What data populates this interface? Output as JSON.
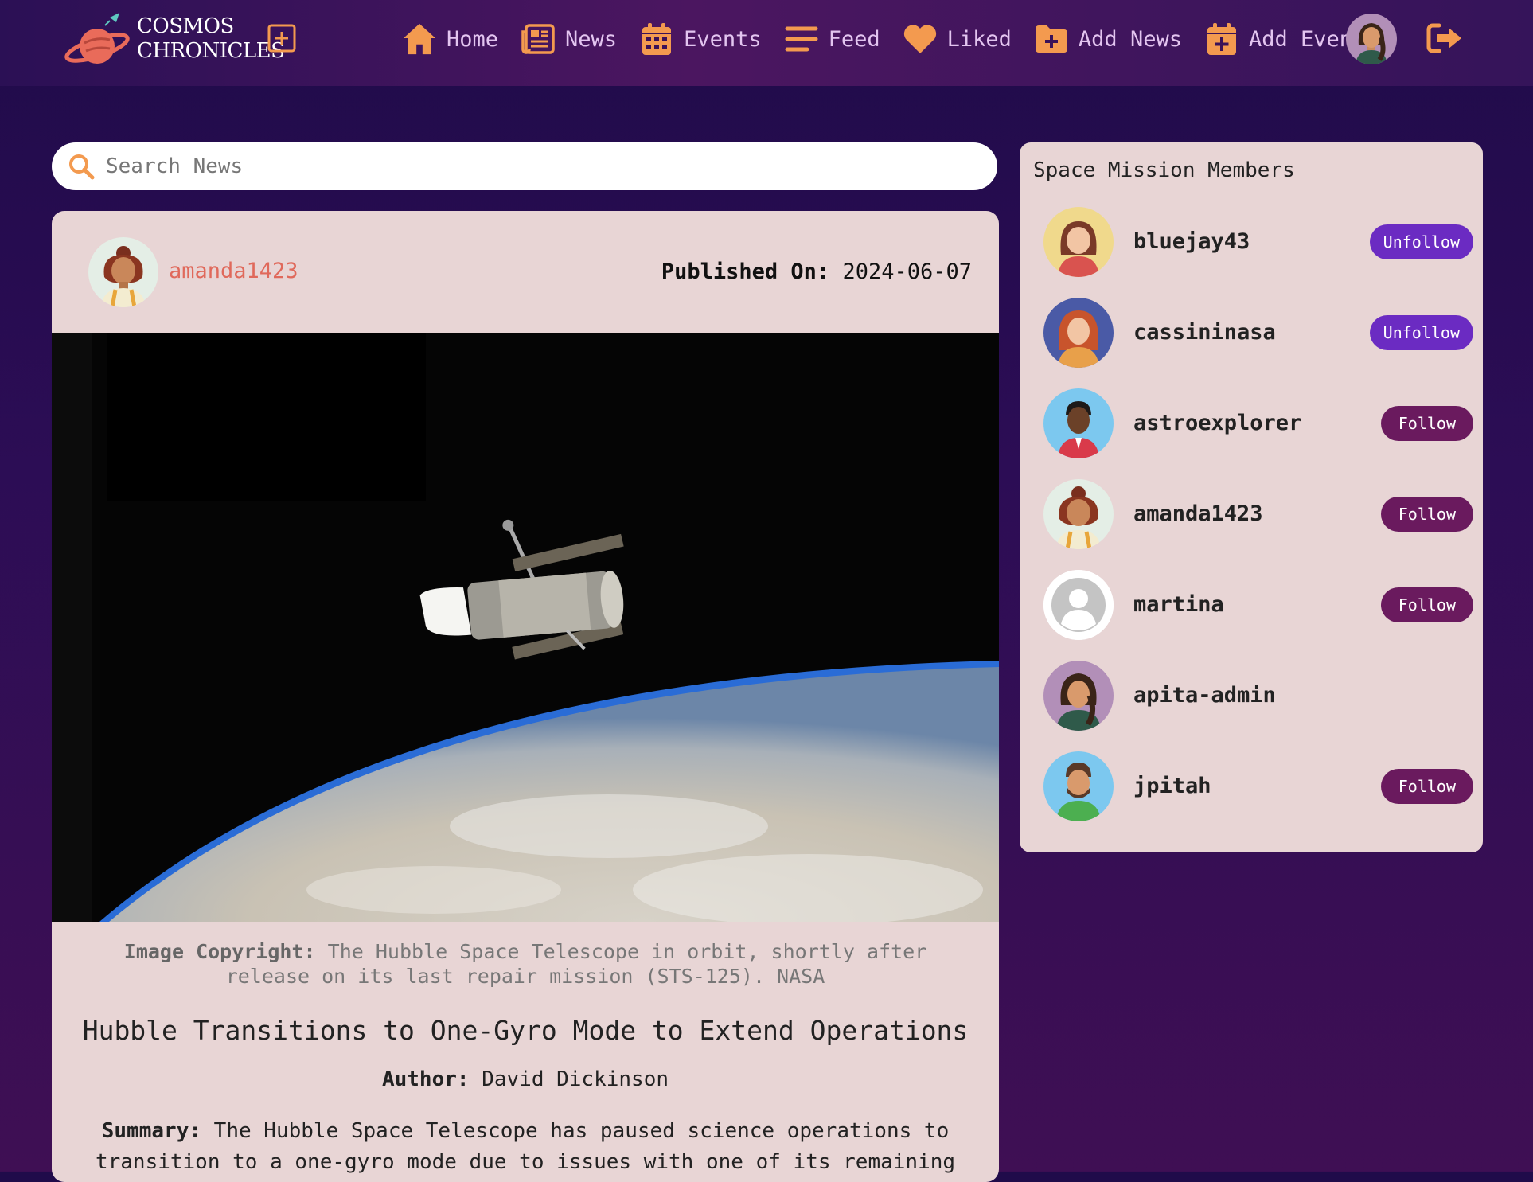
{
  "brand": {
    "line1": "COSMOS",
    "line2": "CHRONICLES"
  },
  "nav": [
    {
      "label": "Home",
      "icon": "home-icon"
    },
    {
      "label": "News",
      "icon": "newspaper-icon"
    },
    {
      "label": "Events",
      "icon": "calendar-icon"
    },
    {
      "label": "Feed",
      "icon": "feed-icon"
    },
    {
      "label": "Liked",
      "icon": "heart-icon"
    },
    {
      "label": "Add News",
      "icon": "folder-plus-icon"
    },
    {
      "label": "Add Events",
      "icon": "calendar-plus-icon"
    }
  ],
  "colors": {
    "accent": "#f39a4f",
    "navText": "#e3c5f0",
    "card": "#e8d5d5",
    "follow": "#6a1a5e",
    "unfollow": "#6b2bc2"
  },
  "search": {
    "placeholder": "Search News"
  },
  "post": {
    "username": "amanda1423",
    "published_label": "Published On:",
    "published_date": "2024-06-07",
    "copyright_label": "Image Copyright:",
    "copyright_text": "The Hubble Space Telescope in orbit, shortly after release on its last repair mission (STS-125). NASA",
    "title": "Hubble Transitions to One-Gyro Mode to Extend Operations",
    "author_label": "Author:",
    "author": "David Dickinson",
    "summary_label": "Summary:",
    "summary": "The Hubble Space Telescope has paused science operations to transition to a one-gyro mode due to issues with one of its remaining"
  },
  "members": {
    "title": "Space Mission Members",
    "list": [
      {
        "name": "bluejay43",
        "action": "Unfollow"
      },
      {
        "name": "cassininasa",
        "action": "Unfollow"
      },
      {
        "name": "astroexplorer",
        "action": "Follow"
      },
      {
        "name": "amanda1423",
        "action": "Follow"
      },
      {
        "name": "martina",
        "action": "Follow"
      },
      {
        "name": "apita-admin",
        "action": ""
      },
      {
        "name": "jpitah",
        "action": "Follow"
      }
    ]
  }
}
